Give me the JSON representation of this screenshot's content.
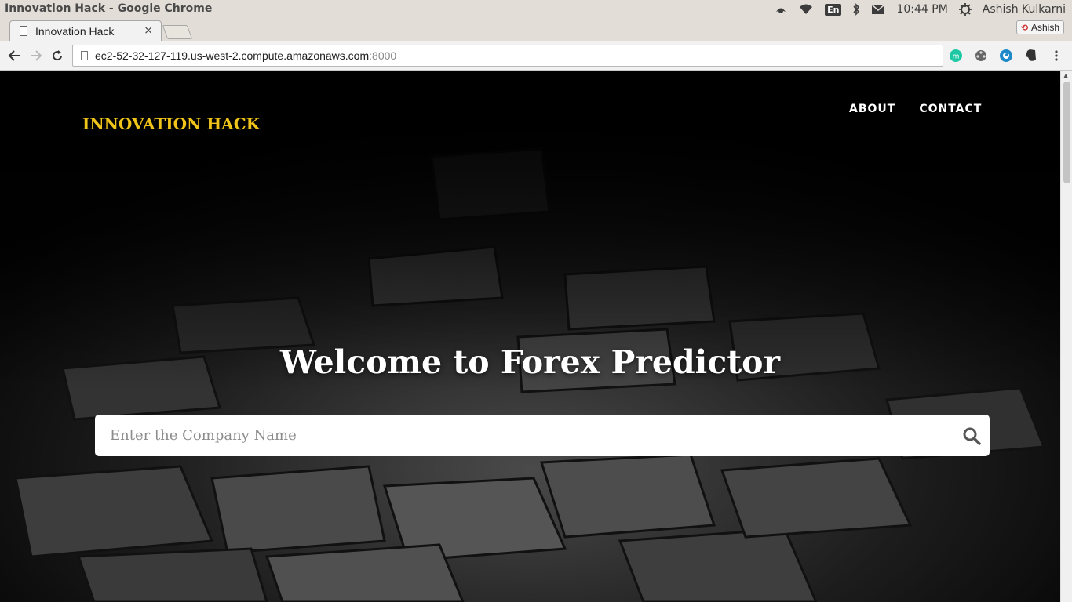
{
  "os": {
    "window_title": "Innovation Hack - Google Chrome",
    "lang": "En",
    "clock": "10:44 PM",
    "user": "Ashish Kulkarni"
  },
  "browser": {
    "tab_title": "Innovation Hack",
    "tab_close": "×",
    "profile_name": "Ashish",
    "url_host": "ec2-52-32-127-119.us-west-2.compute.amazonaws.com",
    "url_port": ":8000"
  },
  "site": {
    "brand": "INNOVATION HACK",
    "brand_color": "#f0c419",
    "nav": [
      {
        "label": "ABOUT"
      },
      {
        "label": "CONTACT"
      }
    ],
    "hero_title": "Welcome to Forex Predictor",
    "search": {
      "placeholder": "Enter the Company Name"
    }
  },
  "icons": [
    "dropbox-icon",
    "wifi-icon",
    "bluetooth-icon",
    "mail-icon",
    "power-icon",
    "back-icon",
    "forward-icon",
    "reload-icon",
    "page-icon",
    "search-icon"
  ]
}
